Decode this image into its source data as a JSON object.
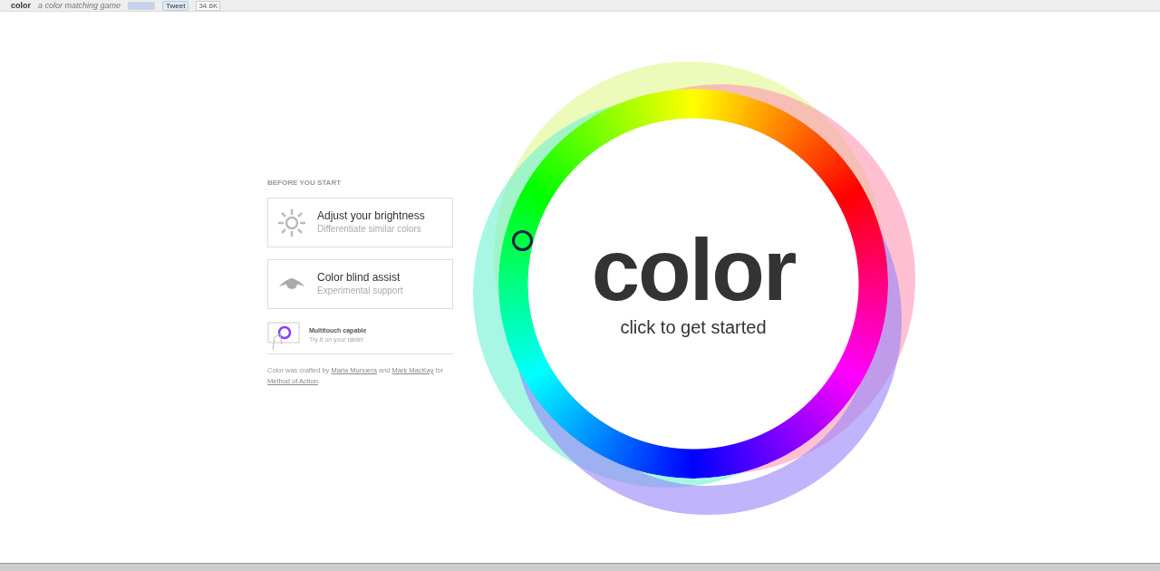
{
  "top_bar": {
    "logo": "color",
    "tagline": "a color matching game",
    "tweet_button": "Tweet",
    "tweet_count": "34.6K"
  },
  "intro": {
    "heading": "BEFORE YOU START",
    "options": [
      {
        "kind": "brightness",
        "title": "Adjust your brightness",
        "subtitle": "Differentiate similar colors"
      },
      {
        "kind": "colorblind",
        "title": "Color blind assist",
        "subtitle": "Experimental support"
      }
    ],
    "multitouch": {
      "title": "Multitouch capable",
      "subtitle": "Try it on your tablet"
    },
    "credits": [
      {
        "text": "Color was crafted by ",
        "link": false
      },
      {
        "text": "Maria Munuera",
        "link": true
      },
      {
        "text": " and ",
        "link": false
      },
      {
        "text": "Mark MacKay",
        "link": true
      },
      {
        "text": " for ",
        "link": false
      },
      {
        "text": "Method of Action",
        "link": true
      },
      {
        "text": ".",
        "link": false
      }
    ]
  },
  "wheel": {
    "title": "color",
    "prompt": "click to get started"
  }
}
